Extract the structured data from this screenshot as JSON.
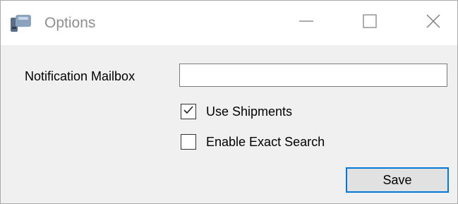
{
  "window": {
    "title": "Options",
    "icon": "app-icon",
    "controls": {
      "minimize_icon": "minimize-icon",
      "maximize_icon": "maximize-icon",
      "close_icon": "close-icon"
    }
  },
  "form": {
    "notification_mailbox": {
      "label": "Notification Mailbox",
      "value": "",
      "placeholder": ""
    },
    "use_shipments": {
      "label": "Use Shipments",
      "checked": true
    },
    "enable_exact_search": {
      "label": "Enable Exact Search",
      "checked": false
    },
    "save_label": "Save"
  },
  "colors": {
    "titlebar": "#ffffff",
    "client_area": "#f0f0f0",
    "accent_border": "#0078d7",
    "button_face": "#e1e1e1"
  }
}
